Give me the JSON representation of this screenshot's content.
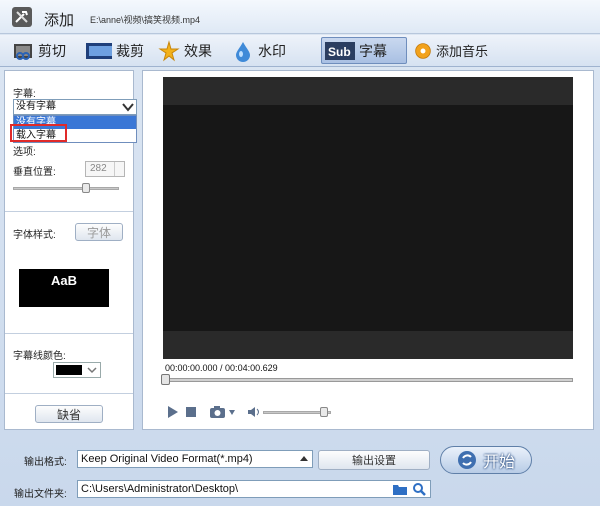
{
  "window": {
    "title": "添加",
    "file_path": "E:\\anne\\视频\\搞笑视频.mp4"
  },
  "tabs": [
    {
      "label": "剪切",
      "icon": "scissors-icon"
    },
    {
      "label": "裁剪",
      "icon": "crop-icon"
    },
    {
      "label": "效果",
      "icon": "effects-icon"
    },
    {
      "label": "水印",
      "icon": "watermark-icon"
    },
    {
      "label": "字幕",
      "icon": "subtitle-icon",
      "active": true,
      "badge": "Sub"
    },
    {
      "label": "添加音乐",
      "icon": "music-icon"
    }
  ],
  "subtitle_panel": {
    "subtitle_label": "字幕:",
    "subtitle_select_value": "没有字幕",
    "dropdown_options": [
      "没有字幕",
      "载入字幕"
    ],
    "options_label": "选项:",
    "vertical_position_label": "垂直位置:",
    "vertical_position_value": "282",
    "vertical_position_level": 0.7,
    "font_style_label": "字体样式:",
    "font_button": "字体",
    "font_preview_text": "AaB",
    "line_color_label": "字幕线颜色:",
    "line_color": "#000000",
    "default_button": "缺省"
  },
  "player": {
    "timecode": "00:00:00.000 / 00:04:00.629",
    "seek_position": 0.0,
    "volume_level": 0.95
  },
  "output": {
    "format_label": "输出格式:",
    "format_value": "Keep Original Video Format(*.mp4)",
    "settings_button": "输出设置",
    "folder_label": "输出文件夹:",
    "folder_value": "C:\\Users\\Administrator\\Desktop\\",
    "start_button": "开始"
  },
  "colors": {
    "accent": "#3a77d6",
    "highlight_box": "#e02a2a",
    "video_bg": "#171717"
  }
}
